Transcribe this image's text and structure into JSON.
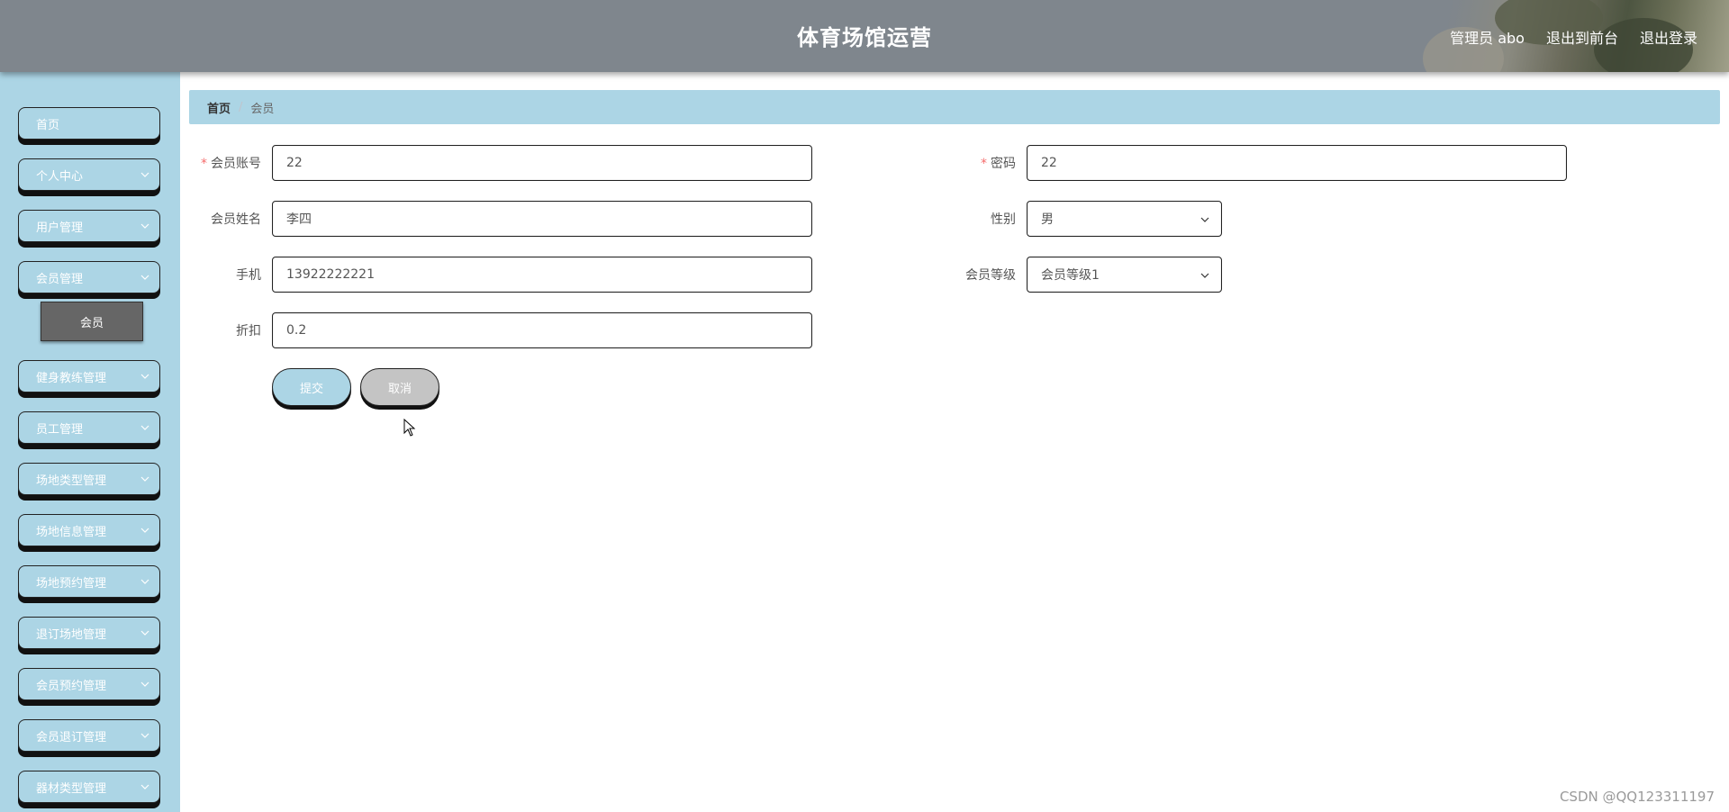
{
  "header": {
    "title": "体育场馆运营",
    "user_label": "管理员 abo",
    "front_label": "退出到前台",
    "logout_label": "退出登录"
  },
  "sidebar": {
    "items": [
      {
        "label": "首页"
      },
      {
        "label": "个人中心"
      },
      {
        "label": "用户管理"
      },
      {
        "label": "会员管理"
      },
      {
        "label": "健身教练管理"
      },
      {
        "label": "员工管理"
      },
      {
        "label": "场地类型管理"
      },
      {
        "label": "场地信息管理"
      },
      {
        "label": "场地预约管理"
      },
      {
        "label": "退订场地管理"
      },
      {
        "label": "会员预约管理"
      },
      {
        "label": "会员退订管理"
      },
      {
        "label": "器材类型管理"
      }
    ],
    "active_sub": "会员"
  },
  "breadcrumb": {
    "home": "首页",
    "current": "会员"
  },
  "form": {
    "account": {
      "label": "会员账号",
      "value": "22",
      "required": "*"
    },
    "password": {
      "label": "密码",
      "value": "22",
      "required": "*"
    },
    "name": {
      "label": "会员姓名",
      "value": "李四"
    },
    "gender": {
      "label": "性别",
      "value": "男"
    },
    "phone": {
      "label": "手机",
      "value": "13922222221"
    },
    "level": {
      "label": "会员等级",
      "value": "会员等级1"
    },
    "discount": {
      "label": "折扣",
      "value": "0.2"
    },
    "submit_label": "提交",
    "cancel_label": "取消"
  },
  "watermark": "CSDN @QQ123311197",
  "colors": {
    "header_bg": "#7f868d",
    "sidebar_bg": "#acd5e5",
    "active_sub_bg": "#666666",
    "required": "#f56c6c"
  }
}
